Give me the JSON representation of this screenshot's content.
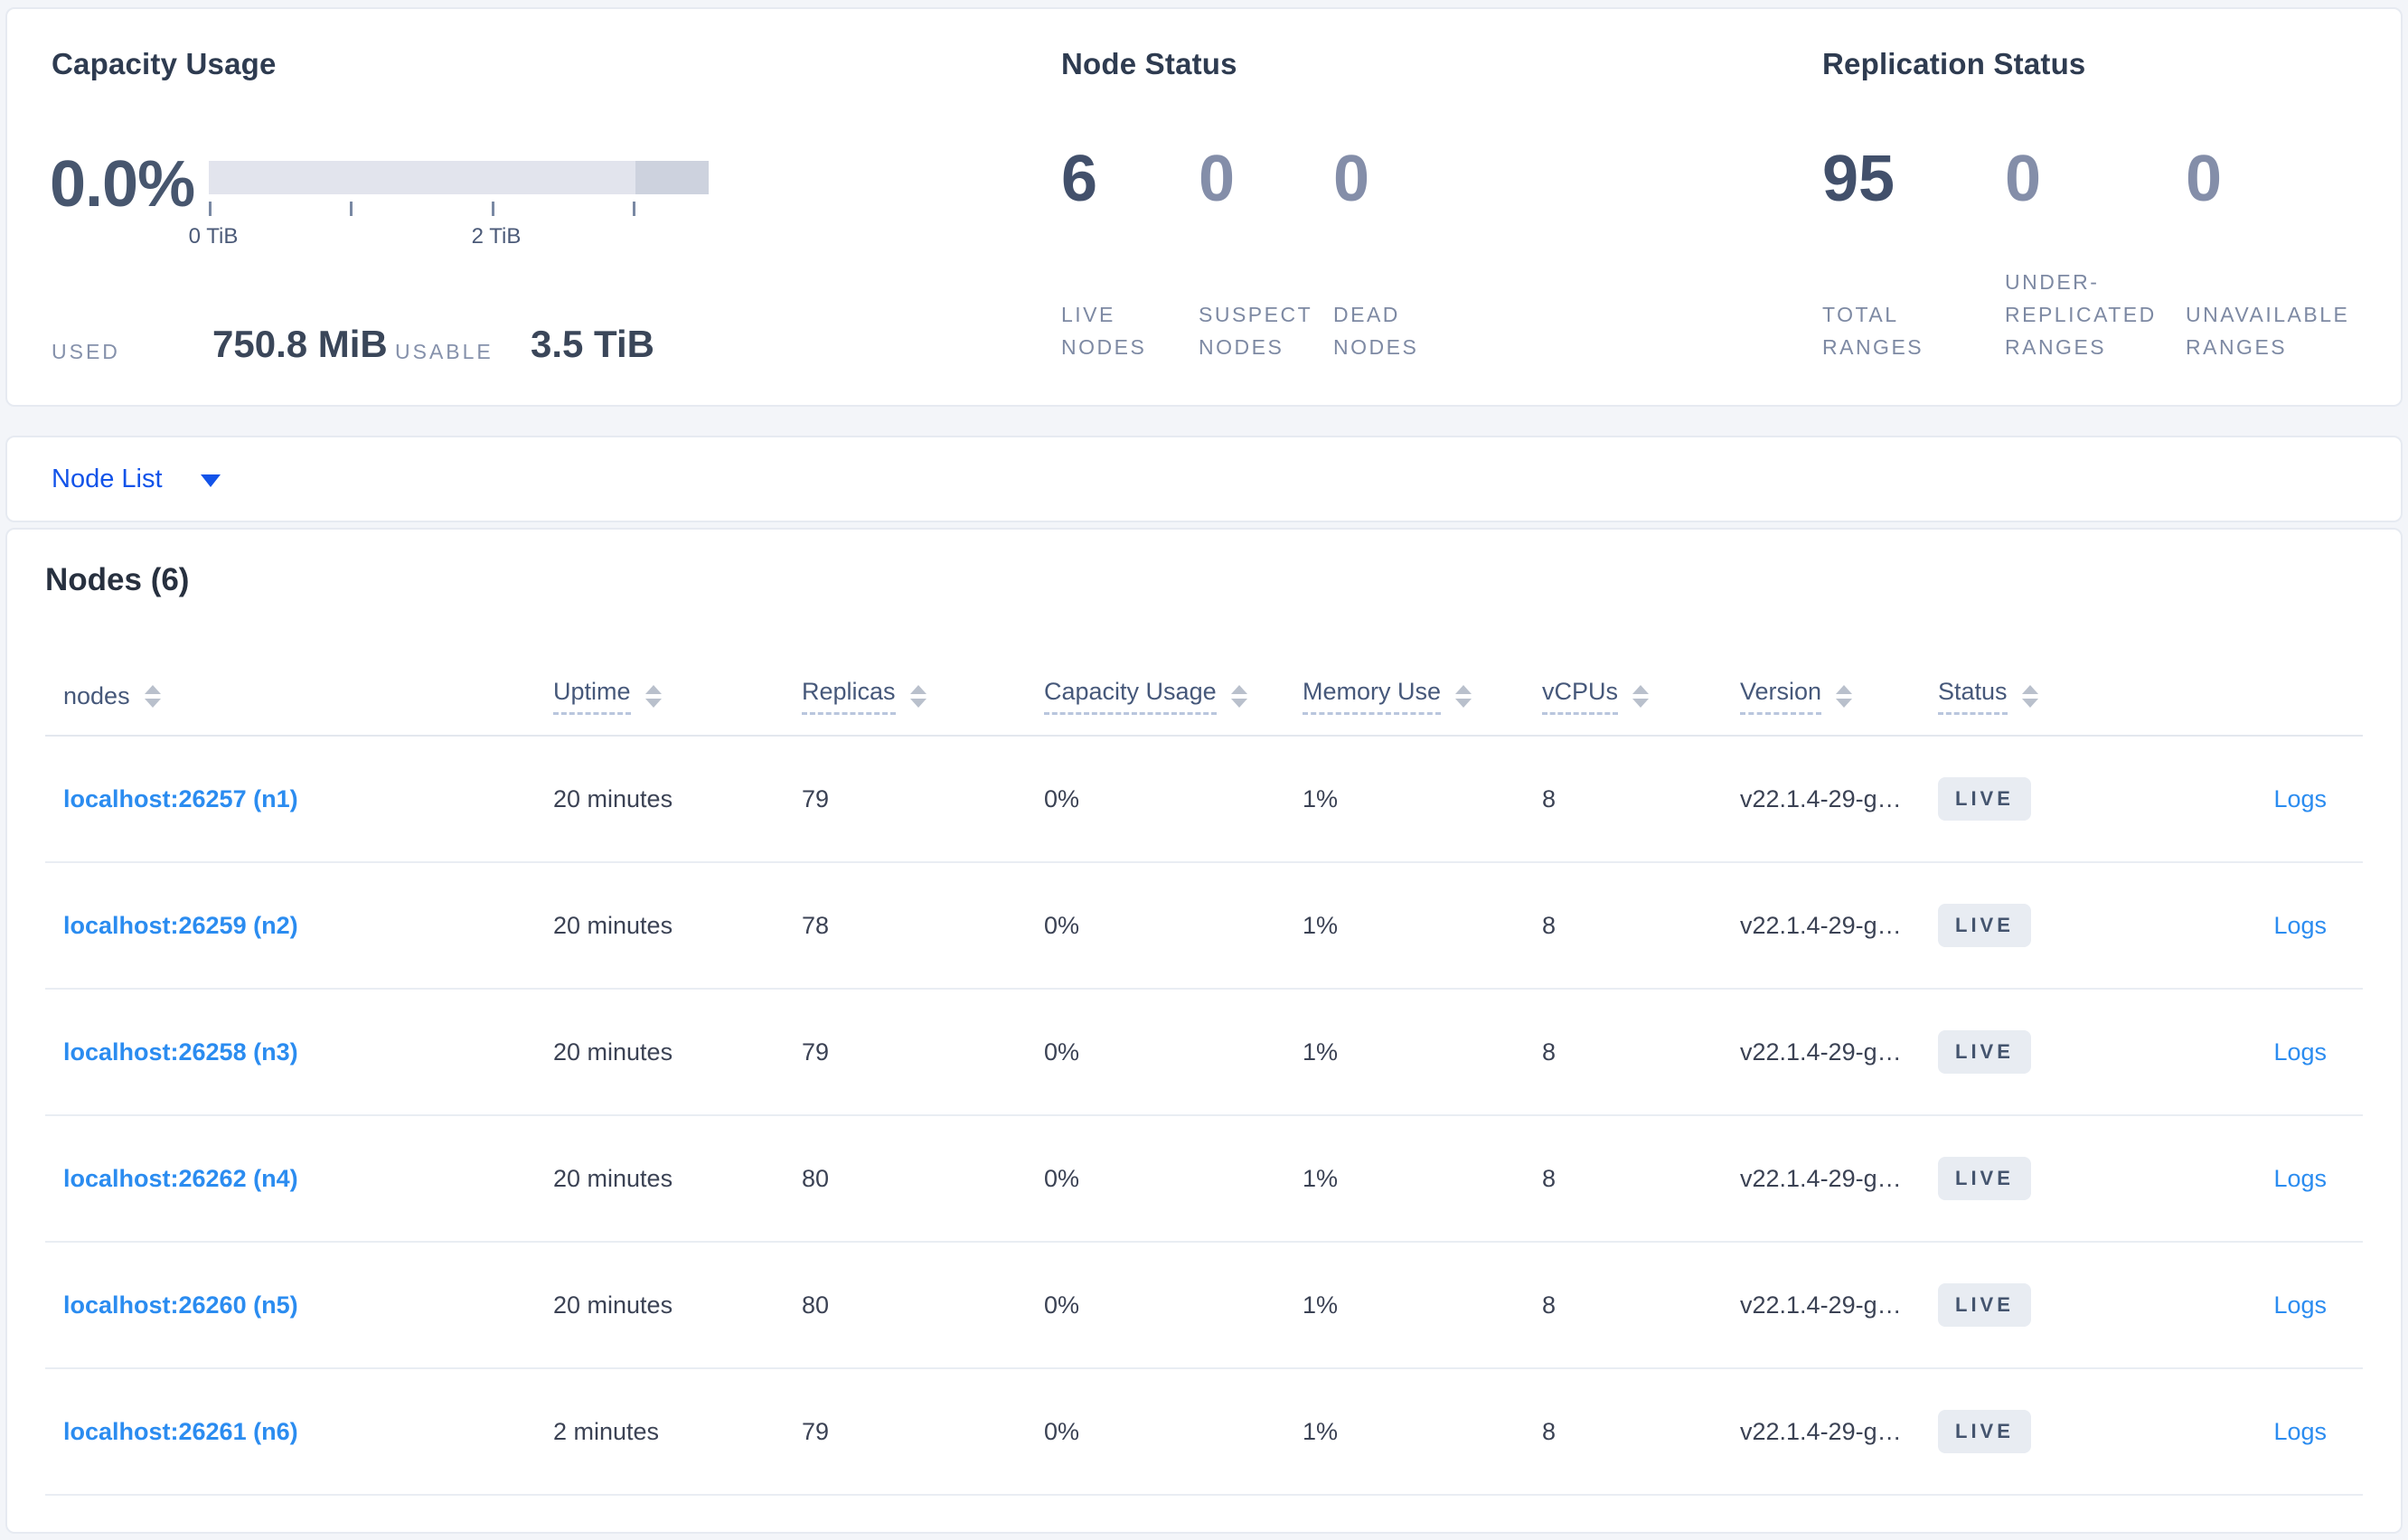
{
  "summary": {
    "capacity": {
      "title": "Capacity Usage",
      "percent": "0.0%",
      "tick_labels": [
        "0 TiB",
        "2 TiB"
      ],
      "used_label": "USED",
      "used_value": "750.8 MiB",
      "usable_label": "USABLE",
      "usable_value": "3.5 TiB"
    },
    "node_status": {
      "title": "Node Status",
      "stats": [
        {
          "value": "6",
          "label": "LIVE NODES"
        },
        {
          "value": "0",
          "label": "SUSPECT NODES"
        },
        {
          "value": "0",
          "label": "DEAD NODES"
        }
      ]
    },
    "replication_status": {
      "title": "Replication Status",
      "stats": [
        {
          "value": "95",
          "label": "TOTAL RANGES"
        },
        {
          "value": "0",
          "label": "UNDER-REPLICATED RANGES"
        },
        {
          "value": "0",
          "label": "UNAVAILABLE RANGES"
        }
      ]
    }
  },
  "node_list": {
    "label": "Node List"
  },
  "nodes_table": {
    "title": "Nodes (6)",
    "logs_label": "Logs",
    "columns": [
      {
        "label": "nodes"
      },
      {
        "label": "Uptime"
      },
      {
        "label": "Replicas"
      },
      {
        "label": "Capacity Usage"
      },
      {
        "label": "Memory Use"
      },
      {
        "label": "vCPUs"
      },
      {
        "label": "Version"
      },
      {
        "label": "Status"
      }
    ],
    "rows": [
      {
        "node": "localhost:26257 (n1)",
        "uptime": "20 minutes",
        "replicas": "79",
        "capacity": "0%",
        "memory": "1%",
        "vcpus": "8",
        "version": "v22.1.4-29-g…",
        "status": "LIVE"
      },
      {
        "node": "localhost:26259 (n2)",
        "uptime": "20 minutes",
        "replicas": "78",
        "capacity": "0%",
        "memory": "1%",
        "vcpus": "8",
        "version": "v22.1.4-29-g…",
        "status": "LIVE"
      },
      {
        "node": "localhost:26258 (n3)",
        "uptime": "20 minutes",
        "replicas": "79",
        "capacity": "0%",
        "memory": "1%",
        "vcpus": "8",
        "version": "v22.1.4-29-g…",
        "status": "LIVE"
      },
      {
        "node": "localhost:26262 (n4)",
        "uptime": "20 minutes",
        "replicas": "80",
        "capacity": "0%",
        "memory": "1%",
        "vcpus": "8",
        "version": "v22.1.4-29-g…",
        "status": "LIVE"
      },
      {
        "node": "localhost:26260 (n5)",
        "uptime": "20 minutes",
        "replicas": "80",
        "capacity": "0%",
        "memory": "1%",
        "vcpus": "8",
        "version": "v22.1.4-29-g…",
        "status": "LIVE"
      },
      {
        "node": "localhost:26261 (n6)",
        "uptime": "2 minutes",
        "replicas": "79",
        "capacity": "0%",
        "memory": "1%",
        "vcpus": "8",
        "version": "v22.1.4-29-g…",
        "status": "LIVE"
      }
    ]
  },
  "colors": {
    "accent_blue": "#1253e9",
    "link_blue": "#2b8cf0",
    "badge_background": "#e8ecf2",
    "bar_light": "#e2e4ed",
    "bar_dark": "#cdd2de",
    "page_background": "#f3f5f9"
  }
}
